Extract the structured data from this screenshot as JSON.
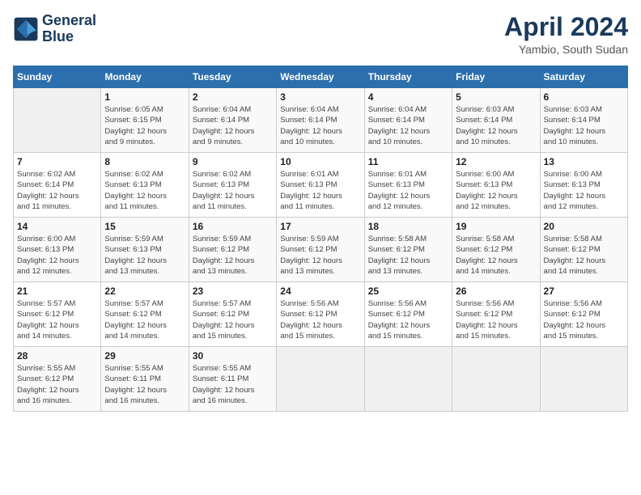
{
  "header": {
    "logo_line1": "General",
    "logo_line2": "Blue",
    "month_title": "April 2024",
    "location": "Yambio, South Sudan"
  },
  "weekdays": [
    "Sunday",
    "Monday",
    "Tuesday",
    "Wednesday",
    "Thursday",
    "Friday",
    "Saturday"
  ],
  "weeks": [
    [
      {
        "day": "",
        "info": ""
      },
      {
        "day": "1",
        "info": "Sunrise: 6:05 AM\nSunset: 6:15 PM\nDaylight: 12 hours\nand 9 minutes."
      },
      {
        "day": "2",
        "info": "Sunrise: 6:04 AM\nSunset: 6:14 PM\nDaylight: 12 hours\nand 9 minutes."
      },
      {
        "day": "3",
        "info": "Sunrise: 6:04 AM\nSunset: 6:14 PM\nDaylight: 12 hours\nand 10 minutes."
      },
      {
        "day": "4",
        "info": "Sunrise: 6:04 AM\nSunset: 6:14 PM\nDaylight: 12 hours\nand 10 minutes."
      },
      {
        "day": "5",
        "info": "Sunrise: 6:03 AM\nSunset: 6:14 PM\nDaylight: 12 hours\nand 10 minutes."
      },
      {
        "day": "6",
        "info": "Sunrise: 6:03 AM\nSunset: 6:14 PM\nDaylight: 12 hours\nand 10 minutes."
      }
    ],
    [
      {
        "day": "7",
        "info": "Sunrise: 6:02 AM\nSunset: 6:14 PM\nDaylight: 12 hours\nand 11 minutes."
      },
      {
        "day": "8",
        "info": "Sunrise: 6:02 AM\nSunset: 6:13 PM\nDaylight: 12 hours\nand 11 minutes."
      },
      {
        "day": "9",
        "info": "Sunrise: 6:02 AM\nSunset: 6:13 PM\nDaylight: 12 hours\nand 11 minutes."
      },
      {
        "day": "10",
        "info": "Sunrise: 6:01 AM\nSunset: 6:13 PM\nDaylight: 12 hours\nand 11 minutes."
      },
      {
        "day": "11",
        "info": "Sunrise: 6:01 AM\nSunset: 6:13 PM\nDaylight: 12 hours\nand 12 minutes."
      },
      {
        "day": "12",
        "info": "Sunrise: 6:00 AM\nSunset: 6:13 PM\nDaylight: 12 hours\nand 12 minutes."
      },
      {
        "day": "13",
        "info": "Sunrise: 6:00 AM\nSunset: 6:13 PM\nDaylight: 12 hours\nand 12 minutes."
      }
    ],
    [
      {
        "day": "14",
        "info": "Sunrise: 6:00 AM\nSunset: 6:13 PM\nDaylight: 12 hours\nand 12 minutes."
      },
      {
        "day": "15",
        "info": "Sunrise: 5:59 AM\nSunset: 6:13 PM\nDaylight: 12 hours\nand 13 minutes."
      },
      {
        "day": "16",
        "info": "Sunrise: 5:59 AM\nSunset: 6:12 PM\nDaylight: 12 hours\nand 13 minutes."
      },
      {
        "day": "17",
        "info": "Sunrise: 5:59 AM\nSunset: 6:12 PM\nDaylight: 12 hours\nand 13 minutes."
      },
      {
        "day": "18",
        "info": "Sunrise: 5:58 AM\nSunset: 6:12 PM\nDaylight: 12 hours\nand 13 minutes."
      },
      {
        "day": "19",
        "info": "Sunrise: 5:58 AM\nSunset: 6:12 PM\nDaylight: 12 hours\nand 14 minutes."
      },
      {
        "day": "20",
        "info": "Sunrise: 5:58 AM\nSunset: 6:12 PM\nDaylight: 12 hours\nand 14 minutes."
      }
    ],
    [
      {
        "day": "21",
        "info": "Sunrise: 5:57 AM\nSunset: 6:12 PM\nDaylight: 12 hours\nand 14 minutes."
      },
      {
        "day": "22",
        "info": "Sunrise: 5:57 AM\nSunset: 6:12 PM\nDaylight: 12 hours\nand 14 minutes."
      },
      {
        "day": "23",
        "info": "Sunrise: 5:57 AM\nSunset: 6:12 PM\nDaylight: 12 hours\nand 15 minutes."
      },
      {
        "day": "24",
        "info": "Sunrise: 5:56 AM\nSunset: 6:12 PM\nDaylight: 12 hours\nand 15 minutes."
      },
      {
        "day": "25",
        "info": "Sunrise: 5:56 AM\nSunset: 6:12 PM\nDaylight: 12 hours\nand 15 minutes."
      },
      {
        "day": "26",
        "info": "Sunrise: 5:56 AM\nSunset: 6:12 PM\nDaylight: 12 hours\nand 15 minutes."
      },
      {
        "day": "27",
        "info": "Sunrise: 5:56 AM\nSunset: 6:12 PM\nDaylight: 12 hours\nand 15 minutes."
      }
    ],
    [
      {
        "day": "28",
        "info": "Sunrise: 5:55 AM\nSunset: 6:12 PM\nDaylight: 12 hours\nand 16 minutes."
      },
      {
        "day": "29",
        "info": "Sunrise: 5:55 AM\nSunset: 6:11 PM\nDaylight: 12 hours\nand 16 minutes."
      },
      {
        "day": "30",
        "info": "Sunrise: 5:55 AM\nSunset: 6:11 PM\nDaylight: 12 hours\nand 16 minutes."
      },
      {
        "day": "",
        "info": ""
      },
      {
        "day": "",
        "info": ""
      },
      {
        "day": "",
        "info": ""
      },
      {
        "day": "",
        "info": ""
      }
    ]
  ]
}
